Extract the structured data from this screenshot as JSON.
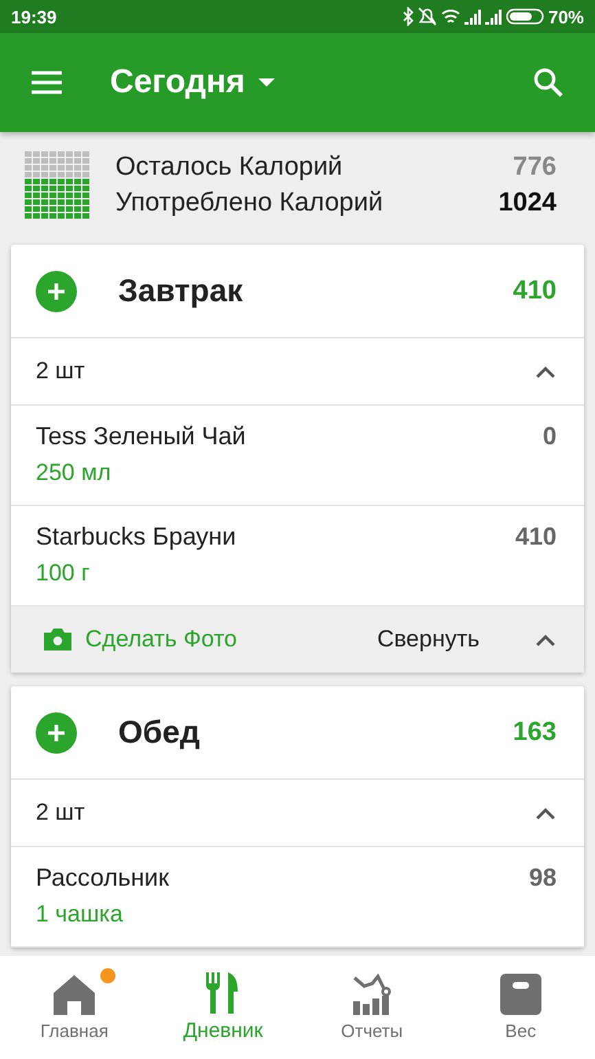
{
  "status_bar": {
    "time": "19:39",
    "battery": "70%"
  },
  "app_bar": {
    "title": "Сегодня"
  },
  "summary": {
    "rows": [
      {
        "label": "Осталось Калорий",
        "value": "776",
        "kind": "remaining"
      },
      {
        "label": "Употреблено Калорий",
        "value": "1024",
        "kind": "consumed"
      }
    ]
  },
  "meals": [
    {
      "name": "Завтрак",
      "calories": "410",
      "count": "2 шт",
      "expanded": true,
      "items": [
        {
          "name": "Tess Зеленый Чай",
          "amount": "250 мл",
          "calories": "0"
        },
        {
          "name": "Starbucks Брауни",
          "amount": "100 г",
          "calories": "410"
        }
      ],
      "footer": {
        "photo": "Сделать Фото",
        "collapse": "Свернуть"
      }
    },
    {
      "name": "Обед",
      "calories": "163",
      "count": "2 шт",
      "expanded": true,
      "items": [
        {
          "name": "Рассольник",
          "amount": "1 чашка",
          "calories": "98"
        }
      ]
    }
  ],
  "bottom_nav": [
    {
      "label": "Главная",
      "kind": "home",
      "selected": false,
      "badge": true
    },
    {
      "label": "Дневник",
      "kind": "diary",
      "selected": true,
      "badge": false
    },
    {
      "label": "Отчеты",
      "kind": "reports",
      "selected": false,
      "badge": false
    },
    {
      "label": "Вес",
      "kind": "weight",
      "selected": false,
      "badge": false
    }
  ]
}
